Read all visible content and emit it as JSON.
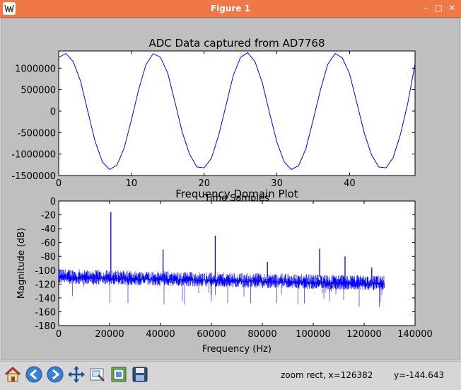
{
  "window": {
    "title": "Figure 1"
  },
  "toolbar": {
    "status_left": "zoom rect, x=126382",
    "status_right": "y=-144.643"
  },
  "colors": {
    "accent": "#f07746",
    "line": "#0000ff",
    "figure_bg": "#bfbfbf"
  },
  "icons": [
    "home-icon",
    "back-arrow-icon",
    "forward-arrow-icon",
    "pan-icon",
    "zoom-icon",
    "subplots-icon",
    "save-icon",
    "minimize-icon",
    "maximize-icon",
    "close-icon"
  ],
  "chart_data": [
    {
      "type": "line",
      "title": "ADC Data captured from AD7768",
      "xlabel": "Time Samples",
      "ylabel": "",
      "xlim": [
        0,
        49
      ],
      "ylim": [
        -1500000,
        1400000
      ],
      "xticks": [
        0,
        10,
        20,
        30,
        40
      ],
      "yticks": [
        -1500000,
        -1000000,
        -500000,
        0,
        500000,
        1000000
      ],
      "series": [
        {
          "x": [
            0,
            1,
            2,
            3,
            4,
            5,
            6,
            7,
            8,
            9,
            10,
            11,
            12,
            13,
            14,
            15,
            16,
            17,
            18,
            19,
            20,
            21,
            22,
            23,
            24,
            25,
            26,
            27,
            28,
            29,
            30,
            31,
            32,
            33,
            34,
            35,
            36,
            37,
            38,
            39,
            40,
            41,
            42,
            43,
            44,
            45,
            46,
            47,
            48,
            49
          ],
          "values": [
            1250000,
            1340000,
            1150000,
            700000,
            0,
            -700000,
            -1180000,
            -1360000,
            -1260000,
            -860000,
            -200000,
            500000,
            1080000,
            1340000,
            1250000,
            880000,
            200000,
            -500000,
            -1000000,
            -1300000,
            -1320000,
            -1100000,
            -560000,
            130000,
            830000,
            1250000,
            1360000,
            1150000,
            660000,
            -50000,
            -720000,
            -1180000,
            -1360000,
            -1270000,
            -870000,
            -200000,
            500000,
            1090000,
            1340000,
            1240000,
            870000,
            190000,
            -500000,
            -1010000,
            -1300000,
            -1320000,
            -1080000,
            -540000,
            180000,
            1100000
          ]
        }
      ]
    },
    {
      "type": "line",
      "title": "Frequency Domain Plot",
      "xlabel": "Frequency (Hz)",
      "ylabel": "Magnitude (dB)",
      "xlim": [
        0,
        140000
      ],
      "ylim": [
        -180,
        0
      ],
      "xticks": [
        0,
        20000,
        40000,
        60000,
        80000,
        100000,
        120000,
        140000
      ],
      "yticks": [
        -180,
        -160,
        -140,
        -120,
        -100,
        -80,
        -60,
        -40,
        -20,
        0
      ],
      "noise_floor": {
        "x_range": [
          0,
          128000
        ],
        "level_start": -110,
        "level_end": -120,
        "spread": 12
      },
      "peaks": [
        {
          "x": 20500,
          "y": -16
        },
        {
          "x": 41000,
          "y": -70
        },
        {
          "x": 61500,
          "y": -50
        },
        {
          "x": 82000,
          "y": -88
        },
        {
          "x": 102500,
          "y": -69
        },
        {
          "x": 112500,
          "y": -80
        },
        {
          "x": 123000,
          "y": -96
        }
      ]
    }
  ]
}
